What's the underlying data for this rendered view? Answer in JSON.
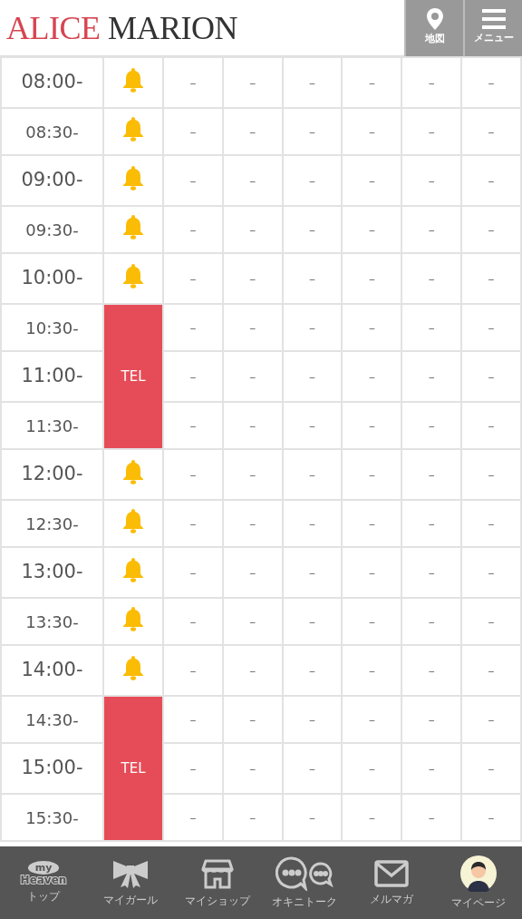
{
  "header": {
    "logo": {
      "first": "ALICE",
      "second": "MARION"
    },
    "buttons": [
      {
        "kind": "map",
        "label": "地図"
      },
      {
        "kind": "menu",
        "label": "メニュー"
      }
    ]
  },
  "rows": [
    {
      "kind": "hour",
      "time": "08:00-",
      "slot": {
        "kind": "bell"
      },
      "cells": [
        "–",
        "–",
        "–",
        "–",
        "–",
        "–"
      ]
    },
    {
      "kind": "half",
      "time": "08:30-",
      "slot": {
        "kind": "bell"
      },
      "cells": [
        "–",
        "–",
        "–",
        "–",
        "–",
        "–"
      ]
    },
    {
      "kind": "hour",
      "time": "09:00-",
      "slot": {
        "kind": "bell"
      },
      "cells": [
        "–",
        "–",
        "–",
        "–",
        "–",
        "–"
      ]
    },
    {
      "kind": "half",
      "time": "09:30-",
      "slot": {
        "kind": "bell"
      },
      "cells": [
        "–",
        "–",
        "–",
        "–",
        "–",
        "–"
      ]
    },
    {
      "kind": "hour",
      "time": "10:00-",
      "slot": {
        "kind": "bell"
      },
      "cells": [
        "–",
        "–",
        "–",
        "–",
        "–",
        "–"
      ]
    },
    {
      "kind": "half",
      "time": "10:30-",
      "slot": {
        "kind": "tel"
      },
      "cells": [
        "–",
        "–",
        "–",
        "–",
        "–",
        "–"
      ]
    },
    {
      "kind": "hour",
      "time": "11:00-",
      "slot": {
        "kind": "tel",
        "label": "TEL"
      },
      "cells": [
        "–",
        "–",
        "–",
        "–",
        "–",
        "–"
      ]
    },
    {
      "kind": "half",
      "time": "11:30-",
      "slot": {
        "kind": "tel"
      },
      "cells": [
        "–",
        "–",
        "–",
        "–",
        "–",
        "–"
      ]
    },
    {
      "kind": "hour",
      "time": "12:00-",
      "slot": {
        "kind": "bell"
      },
      "cells": [
        "–",
        "–",
        "–",
        "–",
        "–",
        "–"
      ]
    },
    {
      "kind": "half",
      "time": "12:30-",
      "slot": {
        "kind": "bell"
      },
      "cells": [
        "–",
        "–",
        "–",
        "–",
        "–",
        "–"
      ]
    },
    {
      "kind": "hour",
      "time": "13:00-",
      "slot": {
        "kind": "bell"
      },
      "cells": [
        "–",
        "–",
        "–",
        "–",
        "–",
        "–"
      ]
    },
    {
      "kind": "half",
      "time": "13:30-",
      "slot": {
        "kind": "bell"
      },
      "cells": [
        "–",
        "–",
        "–",
        "–",
        "–",
        "–"
      ]
    },
    {
      "kind": "hour",
      "time": "14:00-",
      "slot": {
        "kind": "bell"
      },
      "cells": [
        "–",
        "–",
        "–",
        "–",
        "–",
        "–"
      ]
    },
    {
      "kind": "half",
      "time": "14:30-",
      "slot": {
        "kind": "tel"
      },
      "cells": [
        "–",
        "–",
        "–",
        "–",
        "–",
        "–"
      ]
    },
    {
      "kind": "hour",
      "time": "15:00-",
      "slot": {
        "kind": "tel",
        "label": "TEL"
      },
      "cells": [
        "–",
        "–",
        "–",
        "–",
        "–",
        "–"
      ]
    },
    {
      "kind": "half",
      "time": "15:30-",
      "slot": {
        "kind": "tel"
      },
      "cells": [
        "–",
        "–",
        "–",
        "–",
        "–",
        "–"
      ]
    }
  ],
  "bottom_nav": [
    {
      "kind": "heaven",
      "logo_texts": [
        "my",
        "Heaven"
      ],
      "label": "トップ"
    },
    {
      "kind": "ribbon",
      "label": "マイガール"
    },
    {
      "kind": "shop",
      "label": "マイショップ"
    },
    {
      "kind": "chat",
      "label": "オキニトーク"
    },
    {
      "kind": "mail",
      "label": "メルマガ"
    },
    {
      "kind": "avatar",
      "label": "マイページ"
    }
  ]
}
